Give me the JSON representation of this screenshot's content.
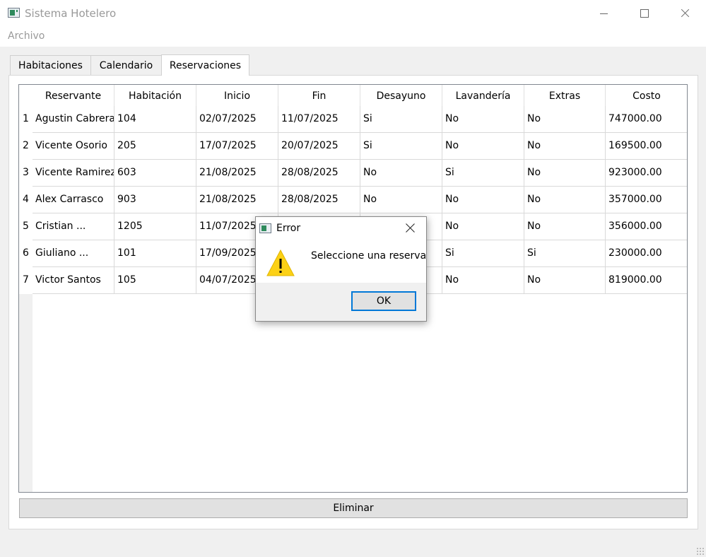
{
  "window": {
    "title": "Sistema Hotelero",
    "icon": "app-window-icon",
    "controls": [
      "minimize-icon",
      "maximize-icon",
      "close-icon"
    ]
  },
  "menu": {
    "items": [
      "Archivo"
    ]
  },
  "tabs": [
    {
      "label": "Habitaciones",
      "active": false
    },
    {
      "label": "Calendario",
      "active": false
    },
    {
      "label": "Reservaciones",
      "active": true
    }
  ],
  "table": {
    "columns": [
      "Reservante",
      "Habitación",
      "Inicio",
      "Fin",
      "Desayuno",
      "Lavandería",
      "Extras",
      "Costo"
    ],
    "row_numbers": [
      "1",
      "2",
      "3",
      "4",
      "5",
      "6",
      "7"
    ],
    "rows": [
      [
        "Agustin Cabrera",
        "104",
        "02/07/2025",
        "11/07/2025",
        "Si",
        "No",
        "No",
        "747000.00"
      ],
      [
        "Vicente Osorio",
        "205",
        "17/07/2025",
        "20/07/2025",
        "Si",
        "No",
        "No",
        "169500.00"
      ],
      [
        "Vicente Ramirez",
        "603",
        "21/08/2025",
        "28/08/2025",
        "No",
        "Si",
        "No",
        "923000.00"
      ],
      [
        "Alex Carrasco",
        "903",
        "21/08/2025",
        "28/08/2025",
        "No",
        "No",
        "No",
        "357000.00"
      ],
      [
        "Cristian ...",
        "1205",
        "11/07/2025",
        "",
        "",
        "No",
        "No",
        "356000.00"
      ],
      [
        "Giuliano ...",
        "101",
        "17/09/2025",
        "",
        "",
        "Si",
        "Si",
        "230000.00"
      ],
      [
        "Victor Santos",
        "105",
        "04/07/2025",
        "",
        "",
        "No",
        "No",
        "819000.00"
      ]
    ]
  },
  "actions": {
    "delete_label": "Eliminar"
  },
  "dialog": {
    "title": "Error",
    "message": "Seleccione una reserva",
    "ok_label": "OK",
    "icon": "warning-icon"
  },
  "colors": {
    "accent": "#0078d7",
    "warning": "#fcd116",
    "title_text": "#999999"
  }
}
